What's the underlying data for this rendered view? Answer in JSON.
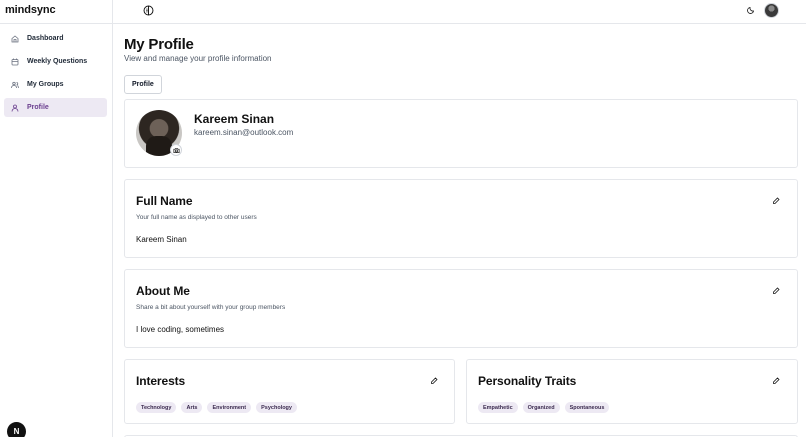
{
  "brand": "mindsync",
  "sidebar": {
    "items": [
      {
        "label": "Dashboard",
        "icon": "home-icon"
      },
      {
        "label": "Weekly Questions",
        "icon": "calendar-icon"
      },
      {
        "label": "My Groups",
        "icon": "users-icon"
      },
      {
        "label": "Profile",
        "icon": "user-icon",
        "active": true
      }
    ]
  },
  "next_badge": "N",
  "header": {
    "title": "My Profile",
    "subtitle": "View and manage your profile information",
    "tab": "Profile"
  },
  "profile": {
    "name": "Kareem Sinan",
    "email": "kareem.sinan@outlook.com"
  },
  "full_name": {
    "title": "Full Name",
    "description": "Your full name as displayed to other users",
    "value": "Kareem Sinan"
  },
  "about": {
    "title": "About Me",
    "description": "Share a bit about yourself with your group members",
    "value": "I love coding, sometimes"
  },
  "interests": {
    "title": "Interests",
    "tags": [
      "Technology",
      "Arts",
      "Environment",
      "Psychology"
    ]
  },
  "traits": {
    "title": "Personality Traits",
    "tags": [
      "Empathetic",
      "Organized",
      "Spontaneous"
    ]
  },
  "colors": {
    "accent": "#6b3f8f",
    "active_bg": "#ede9f3",
    "tag_bg": "#ede9f3"
  }
}
